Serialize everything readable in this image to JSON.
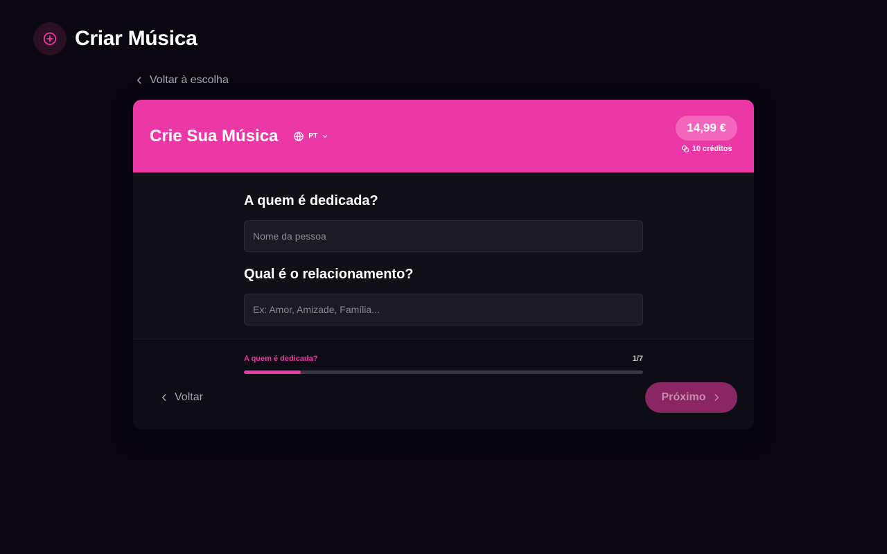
{
  "page": {
    "title": "Criar Música",
    "icon": "plus-circle-icon"
  },
  "nav": {
    "back_label": "Voltar à escolha"
  },
  "card": {
    "title": "Crie Sua Música",
    "language": "PT",
    "price": "14,99 €",
    "credits": "10 créditos"
  },
  "form": {
    "fields": [
      {
        "label": "A quem é dedicada?",
        "placeholder": "Nome da pessoa",
        "value": ""
      },
      {
        "label": "Qual é o relacionamento?",
        "placeholder": "Ex: Amor, Amizade, Família...",
        "value": ""
      }
    ]
  },
  "progress": {
    "step_label": "A quem é dedicada?",
    "step_count": "1/7",
    "fraction": 0.143
  },
  "footer": {
    "back_label": "Voltar",
    "next_label": "Próximo"
  },
  "colors": {
    "accent": "#ec38a6",
    "background": "#0a0710",
    "card_background": "#111016"
  }
}
